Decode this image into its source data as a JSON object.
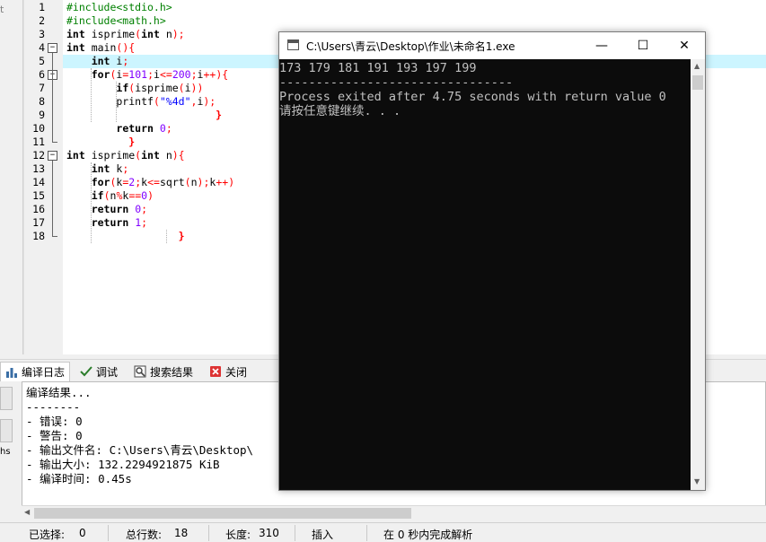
{
  "left_strip": {
    "fragment_top": "t",
    "fragment_bottom": "hs"
  },
  "editor": {
    "line_numbers": [
      "1",
      "2",
      "3",
      "4",
      "5",
      "6",
      "7",
      "8",
      "9",
      "10",
      "11",
      "12",
      "13",
      "14",
      "15",
      "16",
      "17",
      "18"
    ],
    "lines": [
      {
        "tokens": [
          [
            "pp",
            "#include<stdio.h>"
          ]
        ]
      },
      {
        "tokens": [
          [
            "pp",
            "#include<math.h>"
          ]
        ]
      },
      {
        "tokens": [
          [
            "kw",
            "int"
          ],
          [
            "t",
            " isprime"
          ],
          [
            "sym",
            "("
          ],
          [
            "kw",
            "int"
          ],
          [
            "t",
            " n"
          ],
          [
            "sym",
            ");"
          ]
        ]
      },
      {
        "tokens": [
          [
            "kw",
            "int"
          ],
          [
            "t",
            " main"
          ],
          [
            "sym",
            "(){"
          ]
        ]
      },
      {
        "tokens": [
          [
            "t",
            "    "
          ],
          [
            "kw",
            "int"
          ],
          [
            "t",
            " i"
          ],
          [
            "sym",
            ";"
          ]
        ]
      },
      {
        "tokens": [
          [
            "t",
            "    "
          ],
          [
            "kw",
            "for"
          ],
          [
            "sym",
            "("
          ],
          [
            "t",
            "i"
          ],
          [
            "sym",
            "="
          ],
          [
            "num",
            "101"
          ],
          [
            "sym",
            ";"
          ],
          [
            "t",
            "i"
          ],
          [
            "sym",
            "<="
          ],
          [
            "num",
            "200"
          ],
          [
            "sym",
            ";"
          ],
          [
            "t",
            "i"
          ],
          [
            "sym",
            "++){"
          ]
        ]
      },
      {
        "tokens": [
          [
            "t",
            "        "
          ],
          [
            "kw",
            "if"
          ],
          [
            "sym",
            "("
          ],
          [
            "t",
            "isprime"
          ],
          [
            "sym",
            "("
          ],
          [
            "t",
            "i"
          ],
          [
            "sym",
            "))"
          ]
        ]
      },
      {
        "tokens": [
          [
            "t",
            "        printf"
          ],
          [
            "sym",
            "("
          ],
          [
            "str",
            "\"%4d\""
          ],
          [
            "sym",
            ","
          ],
          [
            "t",
            "i"
          ],
          [
            "sym",
            ");"
          ]
        ]
      },
      {
        "tokens": [
          [
            "t",
            "                        "
          ],
          [
            "br",
            "}"
          ]
        ]
      },
      {
        "tokens": [
          [
            "t",
            "        "
          ],
          [
            "kw",
            "return"
          ],
          [
            "t",
            " "
          ],
          [
            "num",
            "0"
          ],
          [
            "sym",
            ";"
          ]
        ]
      },
      {
        "tokens": [
          [
            "t",
            "          "
          ],
          [
            "br",
            "}"
          ]
        ]
      },
      {
        "tokens": [
          [
            "kw",
            "int"
          ],
          [
            "t",
            " isprime"
          ],
          [
            "sym",
            "("
          ],
          [
            "kw",
            "int"
          ],
          [
            "t",
            " n"
          ],
          [
            "sym",
            "){"
          ]
        ]
      },
      {
        "tokens": [
          [
            "t",
            "    "
          ],
          [
            "kw",
            "int"
          ],
          [
            "t",
            " k"
          ],
          [
            "sym",
            ";"
          ]
        ]
      },
      {
        "tokens": [
          [
            "t",
            "    "
          ],
          [
            "kw",
            "for"
          ],
          [
            "sym",
            "("
          ],
          [
            "t",
            "k"
          ],
          [
            "sym",
            "="
          ],
          [
            "num",
            "2"
          ],
          [
            "sym",
            ";"
          ],
          [
            "t",
            "k"
          ],
          [
            "sym",
            "<="
          ],
          [
            "t",
            "sqrt"
          ],
          [
            "sym",
            "("
          ],
          [
            "t",
            "n"
          ],
          [
            "sym",
            ");"
          ],
          [
            "t",
            "k"
          ],
          [
            "sym",
            "++)"
          ]
        ]
      },
      {
        "tokens": [
          [
            "t",
            "    "
          ],
          [
            "kw",
            "if"
          ],
          [
            "sym",
            "("
          ],
          [
            "t",
            "n"
          ],
          [
            "sym",
            "%"
          ],
          [
            "t",
            "k"
          ],
          [
            "sym",
            "=="
          ],
          [
            "num",
            "0"
          ],
          [
            "sym",
            ")"
          ]
        ]
      },
      {
        "tokens": [
          [
            "t",
            "    "
          ],
          [
            "kw",
            "return"
          ],
          [
            "t",
            " "
          ],
          [
            "num",
            "0"
          ],
          [
            "sym",
            ";"
          ]
        ]
      },
      {
        "tokens": [
          [
            "t",
            "    "
          ],
          [
            "kw",
            "return"
          ],
          [
            "t",
            " "
          ],
          [
            "num",
            "1"
          ],
          [
            "sym",
            ";"
          ]
        ]
      },
      {
        "tokens": [
          [
            "t",
            "                  "
          ],
          [
            "br",
            "}"
          ]
        ]
      }
    ],
    "current_line_highlight": "#ccf5ff"
  },
  "console": {
    "title": "C:\\Users\\青云\\Desktop\\作业\\未命名1.exe",
    "minimize_glyph": "—",
    "maximize_glyph": "☐",
    "close_glyph": "✕",
    "output_line": "173 179 181 191 193 197 199",
    "separator": "--------------------------------",
    "exit_line": "Process exited after 4.75 seconds with return value 0",
    "continue_line": "请按任意键继续. . ."
  },
  "bottom_tabs": [
    {
      "label": "编译日志",
      "icon": "chart-icon",
      "active": true
    },
    {
      "label": "调试",
      "icon": "check-icon",
      "active": false
    },
    {
      "label": "搜索结果",
      "icon": "search-icon",
      "active": false
    },
    {
      "label": "关闭",
      "icon": "close-icon",
      "active": false
    }
  ],
  "compile_log": {
    "lines": [
      "编译结果...",
      "--------",
      "- 错误: 0",
      "- 警告: 0",
      "- 输出文件名: C:\\Users\\青云\\Desktop\\",
      "- 输出大小: 132.2294921875 KiB",
      "- 编译时间: 0.45s"
    ]
  },
  "status_bar": {
    "selected_label": "已选择:",
    "selected_value": "0",
    "total_lines_label": "总行数:",
    "total_lines_value": "18",
    "length_label": "长度:",
    "length_value": "310",
    "insert_mode": "插入",
    "parse_status": "在 0 秒内完成解析"
  },
  "colors": {
    "preprocessor": "#008000",
    "symbol": "#ff0000",
    "number": "#8000ff",
    "string": "#0000ff",
    "console_bg": "#0c0c0c",
    "console_text": "#c0c0c0"
  }
}
